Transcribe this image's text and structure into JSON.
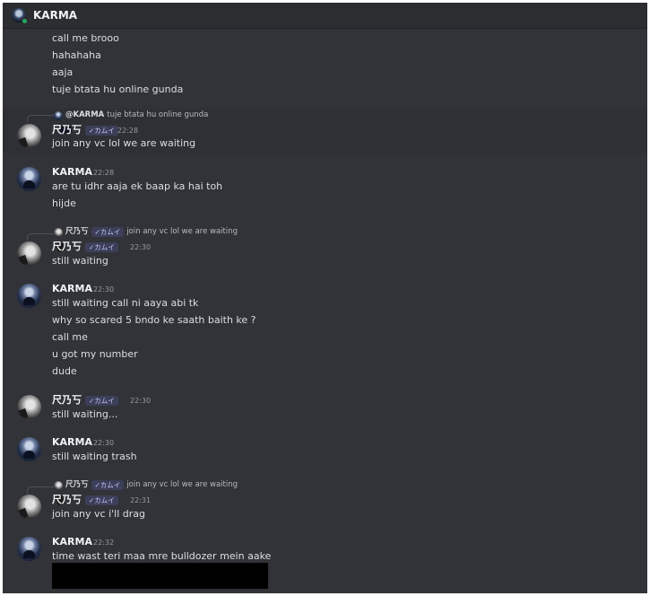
{
  "header": {
    "title": "KARMA"
  },
  "continued_lines": [
    "call me brooo",
    "hahahaha",
    "aaja",
    "tuje btata hu online gunda"
  ],
  "messages": [
    {
      "reply": {
        "name": "@KARMA",
        "text": "tuje btata hu online gunda"
      },
      "author": "尺乃丂",
      "tag": "✓カムイ",
      "time": "22:28",
      "lines": [
        "join any vc lol we are waiting"
      ]
    },
    {
      "author": "KARMA",
      "time": "22:28",
      "lines": [
        "are tu idhr aaja ek baap ka hai toh",
        "hijde"
      ]
    },
    {
      "reply": {
        "name": "尺乃丂",
        "tag": "✓カムイ",
        "text": "join any vc lol we are waiting"
      },
      "author": "尺乃丂",
      "tag": "✓カムイ",
      "time": "22:30",
      "lines": [
        "still waiting"
      ]
    },
    {
      "author": "KARMA",
      "time": "22:30",
      "lines": [
        "still waiting call ni aaya abi tk",
        "why so scared 5 bndo ke saath baith ke ?",
        "call me",
        "u got my number",
        "dude"
      ]
    },
    {
      "author": "尺乃丂",
      "tag": "✓カムイ",
      "time": "22:30",
      "lines": [
        "still waiting..."
      ]
    },
    {
      "author": "KARMA",
      "time": "22:30",
      "lines": [
        "still waiting trash"
      ]
    },
    {
      "reply": {
        "name": "尺乃丂",
        "tag": "✓カムイ",
        "text": "join any vc lol we are waiting"
      },
      "author": "尺乃丂",
      "tag": "✓カムイ",
      "time": "22:31",
      "lines": [
        "join any vc i'll drag"
      ]
    },
    {
      "author": "KARMA",
      "time": "22:32",
      "lines": [
        "time wast teri maa mre bulldozer mein aake"
      ]
    }
  ]
}
